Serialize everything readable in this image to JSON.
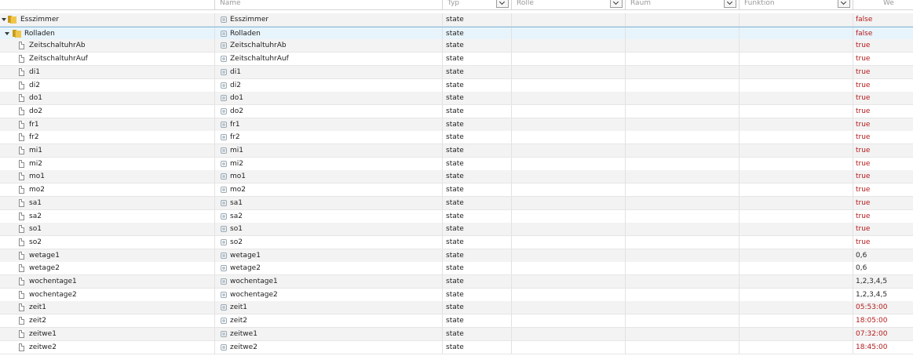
{
  "columns": {
    "name_placeholder": "Name",
    "type_value": "Typ",
    "role_value": "Rolle",
    "room_value": "Raum",
    "function_value": "Funktion",
    "value_header": "We"
  },
  "rows": [
    {
      "id": "Esszimmer",
      "name": "Esszimmer",
      "type": "state",
      "value": "false",
      "kind": "folder",
      "level": 0
    },
    {
      "id": "Rolladen",
      "name": "Rolladen",
      "type": "state",
      "value": "false",
      "kind": "folder",
      "level": 1,
      "selected": true
    },
    {
      "id": "ZeitschaltuhrAb",
      "name": "ZeitschaltuhrAb",
      "type": "state",
      "value": "true",
      "kind": "state",
      "level": 2
    },
    {
      "id": "ZeitschaltuhrAuf",
      "name": "ZeitschaltuhrAuf",
      "type": "state",
      "value": "true",
      "kind": "state",
      "level": 2
    },
    {
      "id": "di1",
      "name": "di1",
      "type": "state",
      "value": "true",
      "kind": "state",
      "level": 2
    },
    {
      "id": "di2",
      "name": "di2",
      "type": "state",
      "value": "true",
      "kind": "state",
      "level": 2
    },
    {
      "id": "do1",
      "name": "do1",
      "type": "state",
      "value": "true",
      "kind": "state",
      "level": 2
    },
    {
      "id": "do2",
      "name": "do2",
      "type": "state",
      "value": "true",
      "kind": "state",
      "level": 2
    },
    {
      "id": "fr1",
      "name": "fr1",
      "type": "state",
      "value": "true",
      "kind": "state",
      "level": 2
    },
    {
      "id": "fr2",
      "name": "fr2",
      "type": "state",
      "value": "true",
      "kind": "state",
      "level": 2
    },
    {
      "id": "mi1",
      "name": "mi1",
      "type": "state",
      "value": "true",
      "kind": "state",
      "level": 2
    },
    {
      "id": "mi2",
      "name": "mi2",
      "type": "state",
      "value": "true",
      "kind": "state",
      "level": 2
    },
    {
      "id": "mo1",
      "name": "mo1",
      "type": "state",
      "value": "true",
      "kind": "state",
      "level": 2
    },
    {
      "id": "mo2",
      "name": "mo2",
      "type": "state",
      "value": "true",
      "kind": "state",
      "level": 2
    },
    {
      "id": "sa1",
      "name": "sa1",
      "type": "state",
      "value": "true",
      "kind": "state",
      "level": 2
    },
    {
      "id": "sa2",
      "name": "sa2",
      "type": "state",
      "value": "true",
      "kind": "state",
      "level": 2
    },
    {
      "id": "so1",
      "name": "so1",
      "type": "state",
      "value": "true",
      "kind": "state",
      "level": 2
    },
    {
      "id": "so2",
      "name": "so2",
      "type": "state",
      "value": "true",
      "kind": "state",
      "level": 2
    },
    {
      "id": "wetage1",
      "name": "wetage1",
      "type": "state",
      "value": "0,6",
      "kind": "state",
      "level": 2
    },
    {
      "id": "wetage2",
      "name": "wetage2",
      "type": "state",
      "value": "0,6",
      "kind": "state",
      "level": 2
    },
    {
      "id": "wochentage1",
      "name": "wochentage1",
      "type": "state",
      "value": "1,2,3,4,5",
      "kind": "state",
      "level": 2
    },
    {
      "id": "wochentage2",
      "name": "wochentage2",
      "type": "state",
      "value": "1,2,3,4,5",
      "kind": "state",
      "level": 2
    },
    {
      "id": "zeit1",
      "name": "zeit1",
      "type": "state",
      "value": "05:53:00",
      "kind": "state",
      "level": 2
    },
    {
      "id": "zeit2",
      "name": "zeit2",
      "type": "state",
      "value": "18:05:00",
      "kind": "state",
      "level": 2
    },
    {
      "id": "zeitwe1",
      "name": "zeitwe1",
      "type": "state",
      "value": "07:32:00",
      "kind": "state",
      "level": 2
    },
    {
      "id": "zeitwe2",
      "name": "zeitwe2",
      "type": "state",
      "value": "18:45:00",
      "kind": "state",
      "level": 2
    }
  ],
  "colors": {
    "value_boolean": "#b41a1a",
    "value_time": "#b41a1a",
    "value_other": "#2a2a2a",
    "selected_row": "#e8f4fb"
  }
}
